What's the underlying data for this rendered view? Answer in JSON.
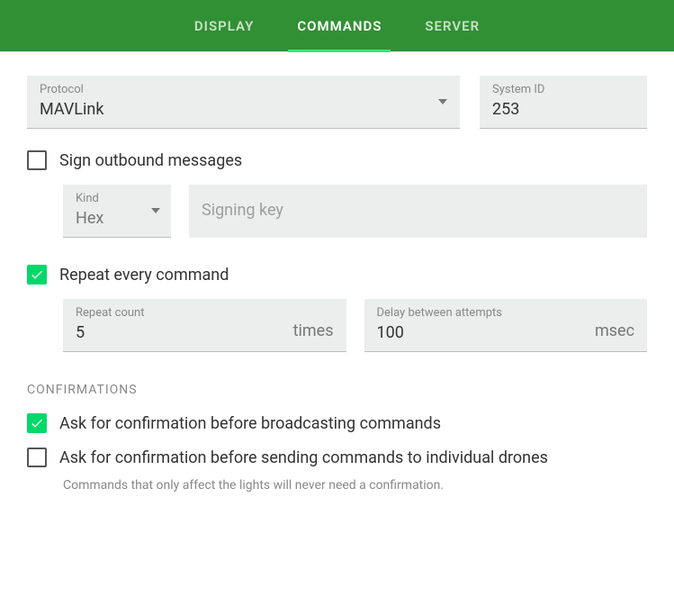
{
  "tabs": {
    "display": "DISPLAY",
    "commands": "COMMANDS",
    "server": "SERVER"
  },
  "protocol": {
    "label": "Protocol",
    "value": "MAVLink"
  },
  "system_id": {
    "label": "System ID",
    "value": "253"
  },
  "sign": {
    "label": "Sign outbound messages",
    "kind_label": "Kind",
    "kind_value": "Hex",
    "key_placeholder": "Signing key"
  },
  "repeat": {
    "label": "Repeat every command",
    "count_label": "Repeat count",
    "count_value": "5",
    "count_suffix": "times",
    "delay_label": "Delay between attempts",
    "delay_value": "100",
    "delay_suffix": "msec"
  },
  "confirmations": {
    "header": "CONFIRMATIONS",
    "broadcast": "Ask for confirmation before broadcasting commands",
    "individual": "Ask for confirmation before sending commands to individual drones",
    "help": "Commands that only affect the lights will never need a confirmation."
  }
}
